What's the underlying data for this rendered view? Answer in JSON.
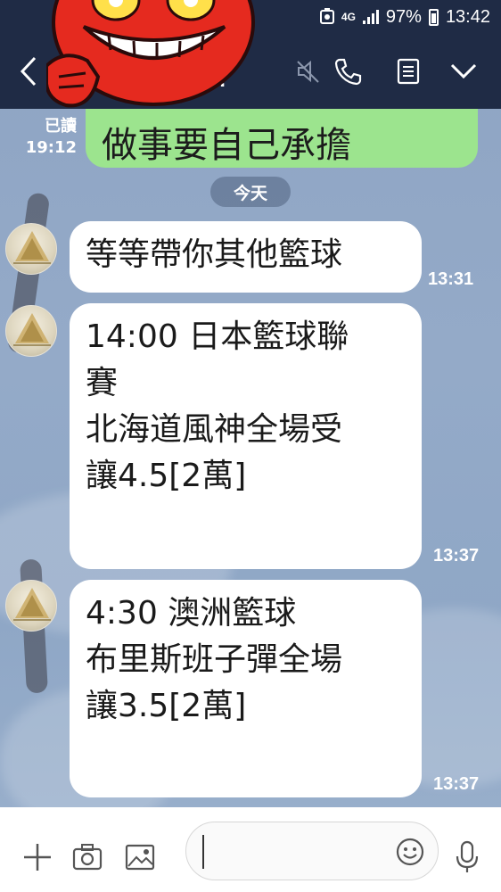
{
  "status_bar": {
    "network": "4G",
    "battery": "97%",
    "time": "13:42"
  },
  "header": {
    "title": "…",
    "icons": [
      "back-icon",
      "mute-icon",
      "phone-icon",
      "notes-icon",
      "chevron-down-icon"
    ]
  },
  "sent_message": {
    "text": "做事要自己承擔",
    "read_label": "已讀",
    "time": "19:12"
  },
  "date_separator": "今天",
  "messages": [
    {
      "lines": [
        "等等帶你其他籃球"
      ],
      "time": "13:31"
    },
    {
      "lines": [
        "14:00 日本籃球聯",
        "賽",
        "",
        "北海道風神全場受",
        "讓4.5[2萬]"
      ],
      "time": "13:37"
    },
    {
      "lines": [
        "4:30 澳洲籃球",
        "",
        "布里斯班子彈全場",
        "讓3.5[2萬]"
      ],
      "time": "13:37"
    }
  ],
  "input_bar": {
    "placeholder": "",
    "icons": [
      "plus-icon",
      "camera-icon",
      "image-icon",
      "emoji-icon",
      "microphone-icon"
    ]
  },
  "colors": {
    "header_bg": "#1f2b45",
    "sent_bubble": "#9ce48e",
    "received_bubble": "#ffffff",
    "sticker_red": "#e52a1f"
  }
}
